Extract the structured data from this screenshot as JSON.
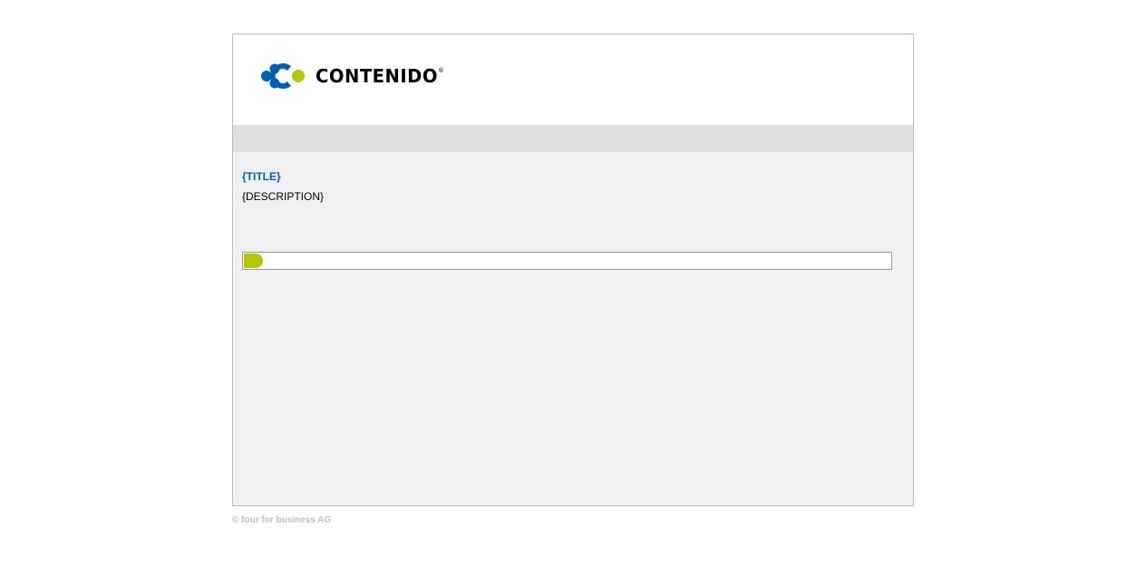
{
  "header": {
    "logo_text": "CONTENIDO",
    "logo_mark": "®",
    "colors": {
      "logo_blue": "#0060b6",
      "logo_green": "#b3c800",
      "logo_text": "#000000"
    }
  },
  "main": {
    "title": "{TITLE}",
    "description": "{DESCRIPTION}",
    "progress": 0.03,
    "progress_color": "#b3c800"
  },
  "footer": {
    "copyright": "© four for business AG"
  }
}
